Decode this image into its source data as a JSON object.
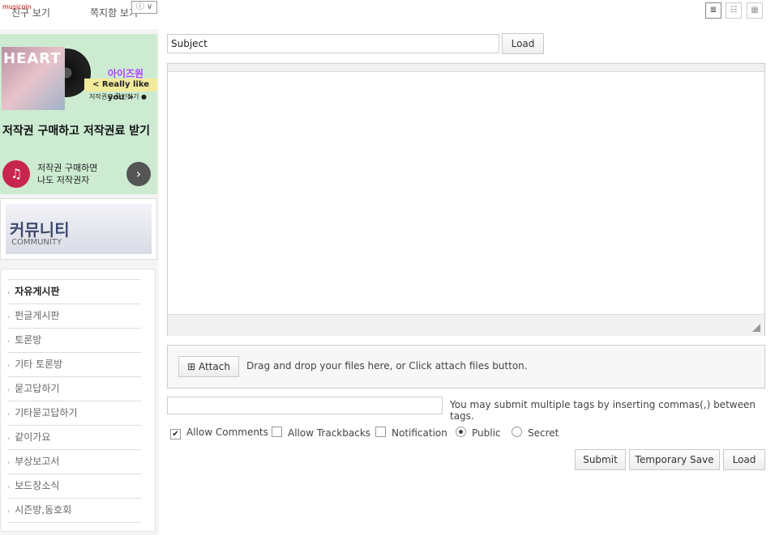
{
  "sidebar": {
    "top_links": [
      "친구 보기",
      "쪽지함 보기"
    ],
    "ad": {
      "brand": "musicoin",
      "info": "ⓘ ∨",
      "album_text": "HEART",
      "artist": "아이즈원",
      "song": "< Really like you >",
      "check": "저작권료 확인하기 ●",
      "headline": "저작권 구매하고 저작권료 받기",
      "logo": "♫",
      "sub_line1": "저작권 구매하면",
      "sub_line2": "나도 저작권자",
      "arrow": "›"
    },
    "community": {
      "title": "커뮤니티",
      "subtitle": "COMMUNITY"
    },
    "menu": [
      {
        "label": "자유게시판"
      },
      {
        "label": "펀글게시판"
      },
      {
        "label": "토론방"
      },
      {
        "label": "기타 토론방"
      },
      {
        "label": "묻고답하기"
      },
      {
        "label": "기타묻고답하기"
      },
      {
        "label": "같이가요"
      },
      {
        "label": "부상보고서"
      },
      {
        "label": "보드장소식"
      },
      {
        "label": "시즌방,동호회"
      }
    ]
  },
  "view_toggles": [
    "≣",
    "☷",
    "▦"
  ],
  "form": {
    "subject_value": "Subject",
    "load_label": "Load",
    "attach_label": "Attach",
    "attach_icon": "⊞",
    "attach_hint": "Drag and drop your files here, or Click attach files button.",
    "tags_value": "",
    "tags_help": "You may submit multiple tags by inserting commas(,) between tags.",
    "options": {
      "allow_comments": "Allow Comments",
      "allow_comments_checked": "✔",
      "allow_trackbacks": "Allow Trackbacks",
      "notification": "Notification",
      "public": "Public",
      "secret": "Secret"
    },
    "buttons": {
      "submit": "Submit",
      "temporary_save": "Temporary Save",
      "load": "Load"
    }
  }
}
